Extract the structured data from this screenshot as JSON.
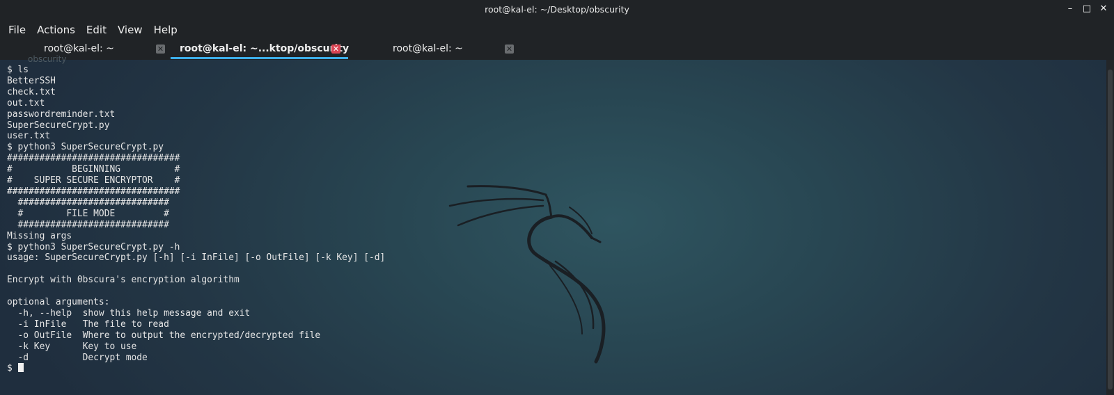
{
  "window": {
    "title": "root@kal-el: ~/Desktop/obscurity",
    "controls": {
      "minimize": "–",
      "maximize": "□",
      "close": "✕"
    }
  },
  "menu": [
    "File",
    "Actions",
    "Edit",
    "View",
    "Help"
  ],
  "tabs": [
    {
      "label": "root@kal-el: ~",
      "active": false
    },
    {
      "label": "root@kal-el: ~...ktop/obscurity",
      "active": true
    },
    {
      "label": "root@kal-el: ~",
      "active": false
    }
  ],
  "ghost_label": "obscurity",
  "terminal": {
    "lines": [
      "$ ls",
      "BetterSSH",
      "check.txt",
      "out.txt",
      "passwordreminder.txt",
      "SuperSecureCrypt.py",
      "user.txt",
      "$ python3 SuperSecureCrypt.py",
      "################################",
      "#           BEGINNING          #",
      "#    SUPER SECURE ENCRYPTOR    #",
      "################################",
      "  ############################",
      "  #        FILE MODE         #",
      "  ############################",
      "Missing args",
      "$ python3 SuperSecureCrypt.py -h",
      "usage: SuperSecureCrypt.py [-h] [-i InFile] [-o OutFile] [-k Key] [-d]",
      "",
      "Encrypt with 0bscura's encryption algorithm",
      "",
      "optional arguments:",
      "  -h, --help  show this help message and exit",
      "  -i InFile   The file to read",
      "  -o OutFile  Where to output the encrypted/decrypted file",
      "  -k Key      Key to use",
      "  -d          Decrypt mode"
    ],
    "prompt": "$ "
  },
  "colors": {
    "accent": "#3daee9",
    "close_active": "#da4453",
    "text": "#e6e6e6"
  }
}
